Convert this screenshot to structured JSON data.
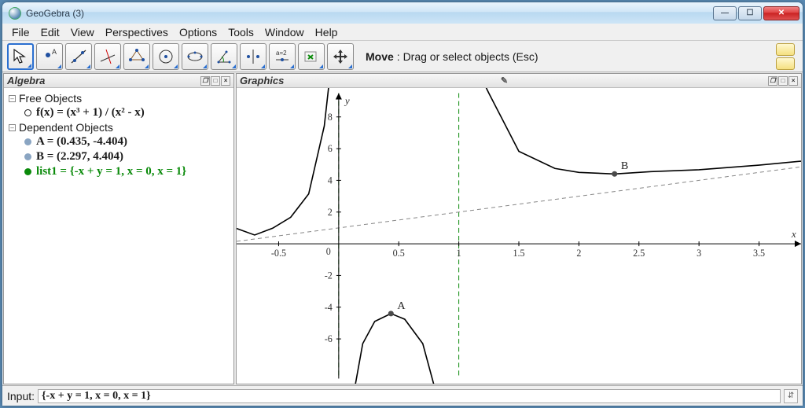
{
  "window": {
    "title": "GeoGebra (3)"
  },
  "menu": {
    "items": [
      "File",
      "Edit",
      "View",
      "Perspectives",
      "Options",
      "Tools",
      "Window",
      "Help"
    ]
  },
  "toolbar": {
    "hint_bold": "Move",
    "hint_rest": ": Drag or select objects (Esc)",
    "tools": [
      {
        "id": "move",
        "name": "move-tool",
        "active": true
      },
      {
        "id": "point",
        "name": "point-tool"
      },
      {
        "id": "line",
        "name": "line-tool"
      },
      {
        "id": "perpendicular",
        "name": "perpendicular-tool"
      },
      {
        "id": "polygon",
        "name": "polygon-tool"
      },
      {
        "id": "circle",
        "name": "circle-tool"
      },
      {
        "id": "ellipse",
        "name": "conic-tool"
      },
      {
        "id": "angle",
        "name": "angle-tool"
      },
      {
        "id": "reflect",
        "name": "reflect-tool"
      },
      {
        "id": "slider",
        "name": "slider-tool"
      },
      {
        "id": "text",
        "name": "text-tool"
      },
      {
        "id": "move-view",
        "name": "move-view-tool"
      }
    ]
  },
  "panels": {
    "algebra": {
      "title": "Algebra"
    },
    "graphics": {
      "title": "Graphics"
    }
  },
  "algebra": {
    "free_label": "Free Objects",
    "dependent_label": "Dependent Objects",
    "items": {
      "f": {
        "label": "f(x) = (x³ + 1) / (x² - x)",
        "color": "#1a1a1a",
        "dot": "#ffffff",
        "ring": "#1a1a1a"
      },
      "A": {
        "label": "A = (0.435, -4.404)",
        "color": "#1a1a1a",
        "dot": "#8aa5c2"
      },
      "B": {
        "label": "B = (2.297, 4.404)",
        "color": "#1a1a1a",
        "dot": "#8aa5c2"
      },
      "list1": {
        "label": "list1 = {-x + y = 1, x = 0, x = 1}",
        "color": "#0a8a0a",
        "dot": "#0a8a0a"
      }
    }
  },
  "input": {
    "label": "Input:",
    "value": "{-x + y = 1, x = 0, x = 1}"
  },
  "chart_data": {
    "type": "line",
    "title": "",
    "xlabel": "x",
    "ylabel": "y",
    "xlim": [
      -0.85,
      3.85
    ],
    "ylim": [
      -8.5,
      9.5
    ],
    "xticks": [
      -0.5,
      0,
      0.5,
      1,
      1.5,
      2,
      2.5,
      3,
      3.5
    ],
    "yticks": [
      -6,
      -4,
      -2,
      2,
      4,
      6,
      8
    ],
    "asymptotes": {
      "vertical": [
        0,
        1
      ],
      "oblique": {
        "slope": 1,
        "intercept": 1
      }
    },
    "points": [
      {
        "name": "A",
        "x": 0.435,
        "y": -4.404
      },
      {
        "name": "B",
        "x": 2.297,
        "y": 4.404
      }
    ],
    "series": [
      {
        "name": "f(x)=(x^3+1)/(x^2-x) left branch",
        "x": [
          -0.85,
          -0.7,
          -0.55,
          -0.4,
          -0.25,
          -0.12,
          -0.06
        ],
        "y": [
          0.964,
          0.552,
          0.981,
          1.671,
          3.144,
          7.432,
          15.7
        ]
      },
      {
        "name": "f(x) middle branch",
        "x": [
          0.02,
          0.05,
          0.1,
          0.2,
          0.3,
          0.435,
          0.55,
          0.7,
          0.85,
          0.93,
          0.97
        ],
        "y": [
          -51,
          -21,
          -11.2,
          -6.3,
          -4.9,
          -4.404,
          -4.76,
          -6.3,
          -12.7,
          -28,
          -76
        ]
      },
      {
        "name": "f(x) right branch",
        "x": [
          1.06,
          1.12,
          1.25,
          1.5,
          1.8,
          2.0,
          2.297,
          2.6,
          3.0,
          3.5,
          3.85
        ],
        "y": [
          34.3,
          18.1,
          9.5,
          5.83,
          4.75,
          4.5,
          4.404,
          4.55,
          4.67,
          4.96,
          5.21
        ]
      }
    ]
  }
}
